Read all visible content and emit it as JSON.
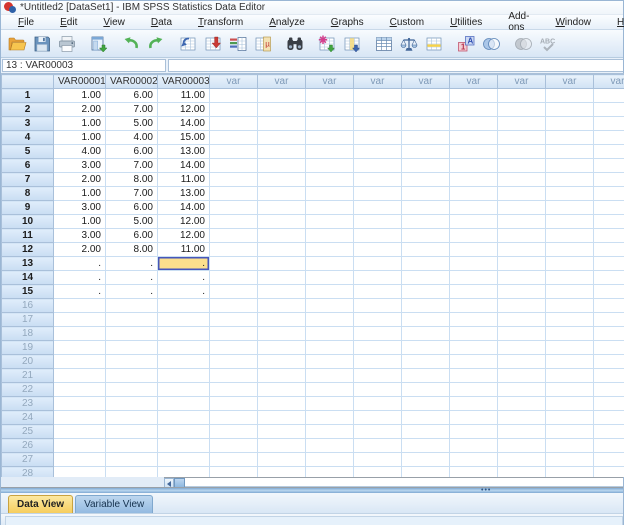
{
  "window": {
    "title": "*Untitled2 [DataSet1] - IBM SPSS Statistics Data Editor"
  },
  "menu": {
    "items": [
      {
        "label": "File",
        "mnemonic": 0
      },
      {
        "label": "Edit",
        "mnemonic": 0
      },
      {
        "label": "View",
        "mnemonic": 0
      },
      {
        "label": "Data",
        "mnemonic": 0
      },
      {
        "label": "Transform",
        "mnemonic": 0
      },
      {
        "label": "Analyze",
        "mnemonic": 0
      },
      {
        "label": "Graphs",
        "mnemonic": 0
      },
      {
        "label": "Custom",
        "mnemonic": 0
      },
      {
        "label": "Utilities",
        "mnemonic": 0
      },
      {
        "label": "Add-ons",
        "mnemonic": 4
      },
      {
        "label": "Window",
        "mnemonic": 0
      },
      {
        "label": "Help",
        "mnemonic": 0
      }
    ]
  },
  "toolbar": {
    "icons": [
      {
        "name": "open-file-icon"
      },
      {
        "name": "save-icon"
      },
      {
        "name": "print-icon"
      },
      {
        "name": "recall-dialogs-icon",
        "gap": true
      },
      {
        "name": "undo-icon",
        "gap": true
      },
      {
        "name": "redo-icon"
      },
      {
        "name": "goto-chart-icon",
        "gap": true
      },
      {
        "name": "goto-case-icon"
      },
      {
        "name": "goto-variable-icon"
      },
      {
        "name": "variables-icon"
      },
      {
        "name": "find-icon",
        "gap": true
      },
      {
        "name": "insert-cases-icon",
        "gap": true
      },
      {
        "name": "insert-variable-icon"
      },
      {
        "name": "split-file-icon",
        "gap": true
      },
      {
        "name": "weight-cases-icon"
      },
      {
        "name": "select-cases-icon"
      },
      {
        "name": "value-labels-icon",
        "gap": true
      },
      {
        "name": "use-variable-sets-icon"
      },
      {
        "name": "show-all-variables-icon",
        "disabled": true,
        "gap": true
      },
      {
        "name": "spell-check-icon",
        "disabled": true
      }
    ]
  },
  "cell_reference": {
    "value": "13 : VAR00003",
    "editor_value": ""
  },
  "grid": {
    "columns": [
      "VAR00001",
      "VAR00002",
      "VAR00003",
      "var",
      "var",
      "var",
      "var",
      "var",
      "var",
      "var",
      "var",
      "var"
    ],
    "named_column_count": 3,
    "row_count": 28,
    "filled_row_count": 15,
    "rows": [
      {
        "n": 1,
        "values": [
          "1.00",
          "6.00",
          "11.00"
        ]
      },
      {
        "n": 2,
        "values": [
          "2.00",
          "7.00",
          "12.00"
        ]
      },
      {
        "n": 3,
        "values": [
          "1.00",
          "5.00",
          "14.00"
        ]
      },
      {
        "n": 4,
        "values": [
          "1.00",
          "4.00",
          "15.00"
        ]
      },
      {
        "n": 5,
        "values": [
          "4.00",
          "6.00",
          "13.00"
        ]
      },
      {
        "n": 6,
        "values": [
          "3.00",
          "7.00",
          "14.00"
        ]
      },
      {
        "n": 7,
        "values": [
          "2.00",
          "8.00",
          "11.00"
        ]
      },
      {
        "n": 8,
        "values": [
          "1.00",
          "7.00",
          "13.00"
        ]
      },
      {
        "n": 9,
        "values": [
          "3.00",
          "6.00",
          "14.00"
        ]
      },
      {
        "n": 10,
        "values": [
          "1.00",
          "5.00",
          "12.00"
        ]
      },
      {
        "n": 11,
        "values": [
          "3.00",
          "6.00",
          "12.00"
        ]
      },
      {
        "n": 12,
        "values": [
          "2.00",
          "8.00",
          "11.00"
        ]
      },
      {
        "n": 13,
        "values": [
          ".",
          ".",
          "."
        ]
      },
      {
        "n": 14,
        "values": [
          ".",
          ".",
          "."
        ]
      },
      {
        "n": 15,
        "values": [
          ".",
          ".",
          "."
        ]
      }
    ],
    "selected_cell": {
      "row": 13,
      "column": "VAR00003",
      "value": "."
    }
  },
  "tabs": [
    {
      "label": "Data View",
      "active": true
    },
    {
      "label": "Variable View",
      "active": false
    }
  ],
  "status_bar": {
    "text": ""
  },
  "colors": {
    "selected_cell_bg": "#fbdf8d",
    "selected_cell_border": "#4656bb",
    "active_tab_bg": "#f6cd5e",
    "header_bg": "#d0e2f4",
    "grid_line": "#cadef2"
  }
}
